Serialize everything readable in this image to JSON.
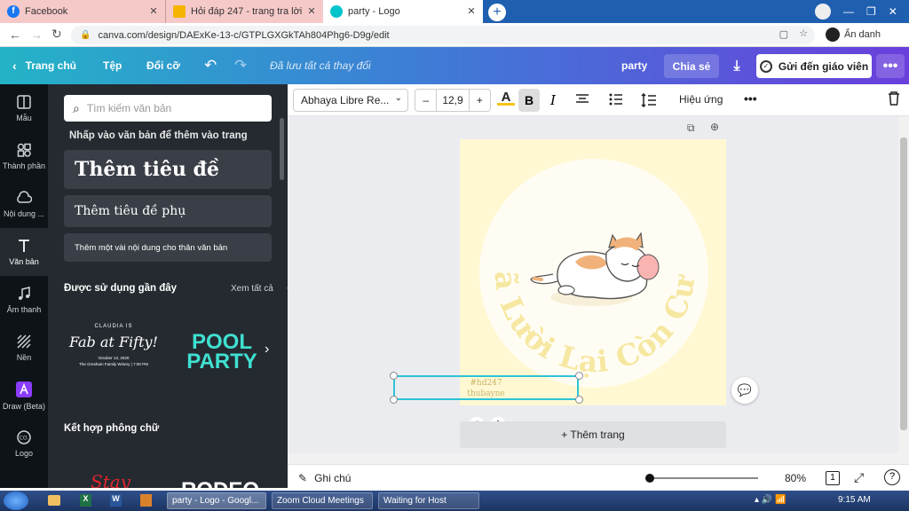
{
  "tabs": [
    {
      "title": "Facebook"
    },
    {
      "title": "Hỏi đáp 247 - trang tra lời"
    },
    {
      "title": "party - Logo"
    }
  ],
  "address": {
    "url": "canva.com/design/DAExKe-13-c/GTPLGXGkTAh804Phg6-D9g/edit",
    "profile": "Ẩn danh"
  },
  "header": {
    "home": "Trang chủ",
    "file": "Tệp",
    "resize": "Đổi cỡ",
    "saved": "Đã lưu tất cả thay đổi",
    "design_name": "party",
    "share": "Chia sẻ",
    "send_teacher": "Gửi đến giáo viên"
  },
  "rail": [
    {
      "label": "Mẫu",
      "icon": "template-icon"
    },
    {
      "label": "Thành phần",
      "icon": "elements-icon"
    },
    {
      "label": "Nội dung ...",
      "icon": "upload-cloud-icon"
    },
    {
      "label": "Văn bản",
      "icon": "text-icon"
    },
    {
      "label": "Âm thanh",
      "icon": "music-icon"
    },
    {
      "label": "Nền",
      "icon": "background-icon"
    },
    {
      "label": "Draw (Beta)",
      "icon": "draw-icon"
    },
    {
      "label": "Logo",
      "icon": "logo-icon"
    }
  ],
  "panel": {
    "search_placeholder": "Tìm kiếm văn bản",
    "hint": "Nhấp vào văn bản để thêm vào trang",
    "add_heading": "Thêm tiêu đề",
    "add_subheading": "Thêm tiêu đề phụ",
    "add_body": "Thêm một vài nội dung cho thân văn bản",
    "recent_title": "Được sử dụng gần đây",
    "see_all": "Xem tất cả",
    "recent_1_small": "CLAUDIA IS",
    "recent_1_main": "Fab at Fifty!",
    "recent_1_sub1": "October 13, 2020",
    "recent_1_sub2": "The Gresham Family Winery | 7:00 PM",
    "recent_2_line1": "POOL",
    "recent_2_line2": "PARTY",
    "combo_title": "Kết hợp phông chữ",
    "combo_1": "Stay",
    "combo_2": "RODEO"
  },
  "toolbar": {
    "font": "Abhaya Libre Re...",
    "font_size": "12,9",
    "bold": "B",
    "italic": "I",
    "effects": "Hiệu ứng"
  },
  "canvas": {
    "arc_text": "Đã Lười Lại Còn Cười",
    "selected_line1": "#hd247",
    "selected_line2": "thubayne",
    "add_page": "+ Thêm trang",
    "arc_color": "#f6e7a1"
  },
  "bottom": {
    "notes": "Ghi chú",
    "zoom": "80%",
    "page_num": "1"
  },
  "taskbar": {
    "items": [
      "party - Logo - Googl...",
      "Zoom Cloud Meetings",
      "Waiting for Host"
    ],
    "time": "9:15 AM"
  },
  "colors": {
    "accent": "#2bc4d6",
    "brand_start": "#24b3c7",
    "brand_end": "#6a3fdc"
  }
}
